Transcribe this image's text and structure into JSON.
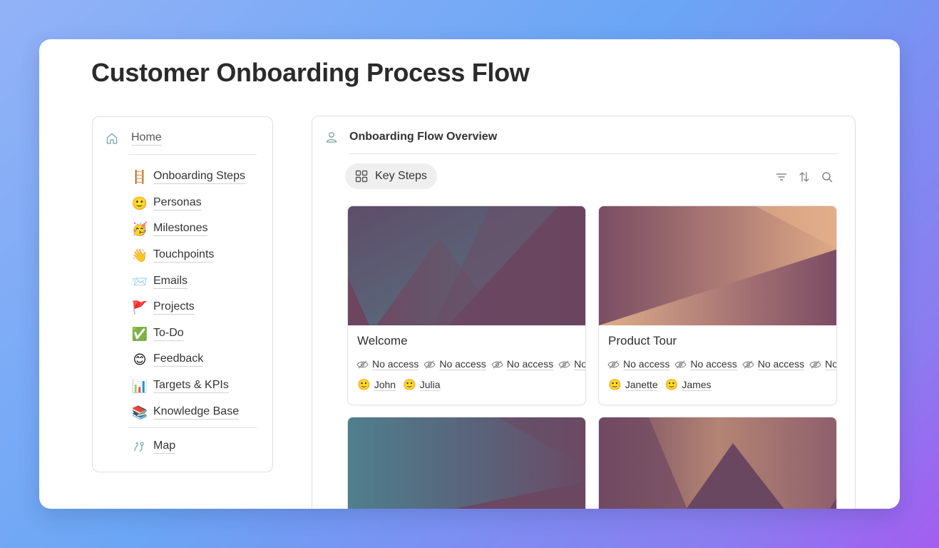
{
  "page": {
    "title": "Customer Onboarding Process Flow"
  },
  "sidebar": {
    "home_label": "Home",
    "items": [
      {
        "emoji": "🪜",
        "label": "Onboarding Steps"
      },
      {
        "emoji": "🙂",
        "label": "Personas"
      },
      {
        "emoji": "🥳",
        "label": "Milestones"
      },
      {
        "emoji": "👋",
        "label": "Touchpoints"
      },
      {
        "emoji": "📨",
        "label": "Emails"
      },
      {
        "emoji": "🚩",
        "label": "Projects"
      },
      {
        "emoji": "✅",
        "label": "To-Do"
      },
      {
        "emoji": "😊",
        "label": "Feedback"
      },
      {
        "emoji": "📊",
        "label": "Targets & KPIs"
      },
      {
        "emoji": "📚",
        "label": "Knowledge Base"
      }
    ],
    "map_label": "Map"
  },
  "main": {
    "title": "Onboarding Flow Overview",
    "view_tab": "Key Steps",
    "cards": [
      {
        "title": "Welcome",
        "access": [
          "No access",
          "No access",
          "No access",
          "No access"
        ],
        "people": [
          {
            "emoji": "🙂",
            "name": "John"
          },
          {
            "emoji": "🙂",
            "name": "Julia"
          }
        ]
      },
      {
        "title": "Product Tour",
        "access": [
          "No access",
          "No access",
          "No access",
          "No access"
        ],
        "people": [
          {
            "emoji": "🙂",
            "name": "Janette"
          },
          {
            "emoji": "🙂",
            "name": "James"
          }
        ]
      },
      {
        "title": "",
        "access": [],
        "people": []
      },
      {
        "title": "",
        "access": [],
        "people": []
      }
    ]
  },
  "colors": {
    "cover_plum": "#6d4560",
    "cover_teal": "#5a7a8a",
    "cover_peach": "#deaa86"
  },
  "icons": {
    "home": "home-icon",
    "person": "person-icon",
    "grid": "grid-icon",
    "filter": "filter-icon",
    "sort": "sort-icon",
    "search": "search-icon",
    "eye_off": "eye-off-icon",
    "map": "map-icon"
  }
}
